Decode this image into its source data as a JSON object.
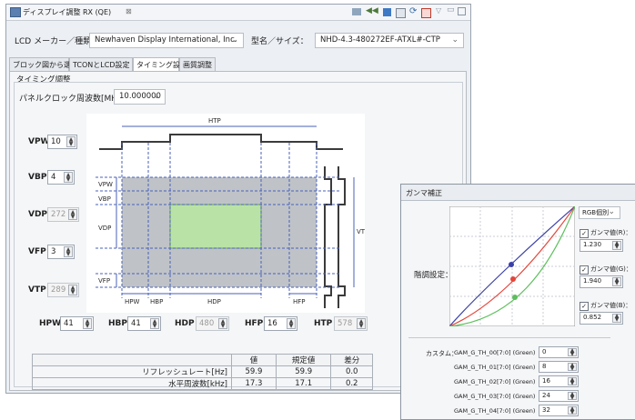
{
  "main_window": {
    "tab_title": "ディスプレイ調整 RX (QE)",
    "close_glyph": "⊠"
  },
  "lcd_row": {
    "maker_label": "LCD メーカー／種類：",
    "maker_value": "Newhaven Display International, Inc.",
    "model_label": "型名／サイズ：",
    "model_value": "NHD-4.3-480272EF-ATXL#-CTP"
  },
  "tabs": [
    {
      "label": "ブロック図から選択"
    },
    {
      "label": "TCONとLCD設定"
    },
    {
      "label": "タイミング設定"
    },
    {
      "label": "画質調整"
    }
  ],
  "timing": {
    "group_label": "タイミング調整",
    "clock_label": "パネルクロック周波数[MHz]:",
    "clock_value": "10.000000",
    "vpw": {
      "label": "VPW",
      "value": "10"
    },
    "vbp": {
      "label": "VBP",
      "value": "4"
    },
    "vdp": {
      "label": "VDP",
      "value": "272"
    },
    "vfp": {
      "label": "VFP",
      "value": "3"
    },
    "vtp": {
      "label": "VTP",
      "value": "289"
    },
    "hpw": {
      "label": "HPW",
      "value": "41"
    },
    "hbp": {
      "label": "HBP",
      "value": "41"
    },
    "hdp": {
      "label": "HDP",
      "value": "480"
    },
    "hfp": {
      "label": "HFP",
      "value": "16"
    },
    "htp": {
      "label": "HTP",
      "value": "578"
    }
  },
  "diagram": {
    "htp": "HTP",
    "vtp": "VTP",
    "vpw": "VPW",
    "vbp": "VBP",
    "vdp": "VDP",
    "vfp": "VFP",
    "hpw": "HPW",
    "hbp": "HBP",
    "hdp": "HDP",
    "hfp": "HFP"
  },
  "results": {
    "headers": [
      "",
      "値",
      "規定値",
      "差分"
    ],
    "rows": [
      {
        "label": "リフレッシュレート[Hz]",
        "value": "59.9",
        "spec": "59.9",
        "diff": "0.0"
      },
      {
        "label": "水平周波数[kHz]",
        "value": "17.3",
        "spec": "17.1",
        "diff": "0.2"
      }
    ]
  },
  "gamma": {
    "title": "ガンマ補正",
    "level_label": "階調設定：",
    "mode_value": "RGB個別",
    "r_label": "ガンマ値(R)：",
    "r_value": "1.230",
    "g_label": "ガンマ値(G)：",
    "g_value": "1.940",
    "b_label": "ガンマ値(B)：",
    "b_value": "0.852",
    "custom_label": "カスタム：",
    "custom_rows": [
      {
        "name": "GAM_G_TH_00[7:0] (Green)",
        "value": "0"
      },
      {
        "name": "GAM_G_TH_01[7:0] (Green)",
        "value": "8"
      },
      {
        "name": "GAM_G_TH_02[7:0] (Green)",
        "value": "16"
      },
      {
        "name": "GAM_G_TH_03[7:0] (Green)",
        "value": "24"
      },
      {
        "name": "GAM_G_TH_04[7:0] (Green)",
        "value": "32"
      }
    ],
    "colors": {
      "red": "#e5453b",
      "green": "#5bbf5b",
      "blue": "#3a3fa8"
    }
  }
}
